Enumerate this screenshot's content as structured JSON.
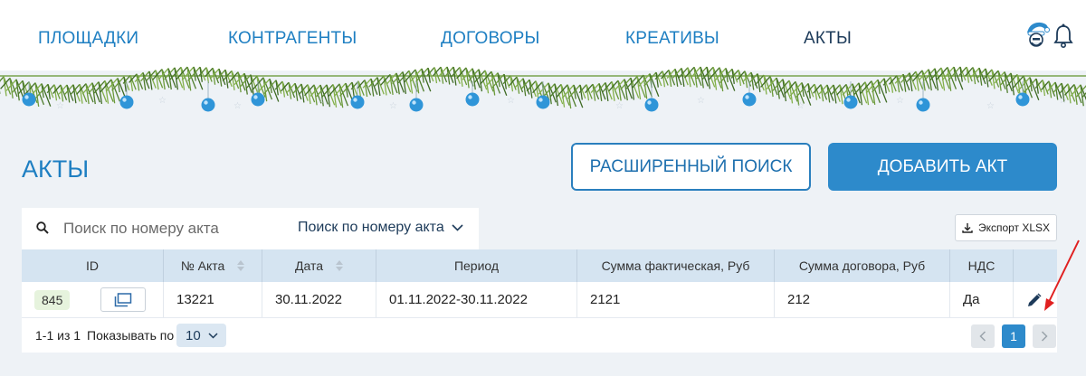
{
  "nav": {
    "items": [
      {
        "label": "ПЛОЩАДКИ"
      },
      {
        "label": "КОНТРАГЕНТЫ"
      },
      {
        "label": "ДОГОВОРЫ"
      },
      {
        "label": "КРЕАТИВЫ"
      },
      {
        "label": "АКТЫ"
      }
    ],
    "active_index": 4,
    "icons": [
      "user-santa-icon",
      "bell-icon"
    ]
  },
  "page": {
    "title": "АКТЫ",
    "advanced_search_label": "РАСШИРЕННЫЙ ПОИСК",
    "add_label": "ДОБАВИТЬ АКТ"
  },
  "search": {
    "placeholder": "Поиск по номеру акта",
    "mode_label": "Поиск по номеру акта"
  },
  "export": {
    "label": "Экспорт XLSX"
  },
  "table": {
    "headers": [
      "ID",
      "№ Акта",
      "Дата",
      "Период",
      "Сумма фактическая, Руб",
      "Сумма договора, Руб",
      "НДС",
      ""
    ],
    "rows": [
      {
        "id": "845",
        "act_number": "13221",
        "date": "30.11.2022",
        "period": "01.11.2022-30.11.2022",
        "sum_actual": "2121",
        "sum_contract": "212",
        "vat": "Да"
      }
    ]
  },
  "footer": {
    "count_text": "1-1 из 1",
    "show_label": "Показывать по",
    "page_size": "10",
    "current_page": "1"
  },
  "colors": {
    "accent": "#2d8acb",
    "nav_link": "#1e7fc2",
    "nav_active": "#1d3b5a",
    "header_bg": "#d5e4f1",
    "annotation_arrow": "#e02020"
  }
}
